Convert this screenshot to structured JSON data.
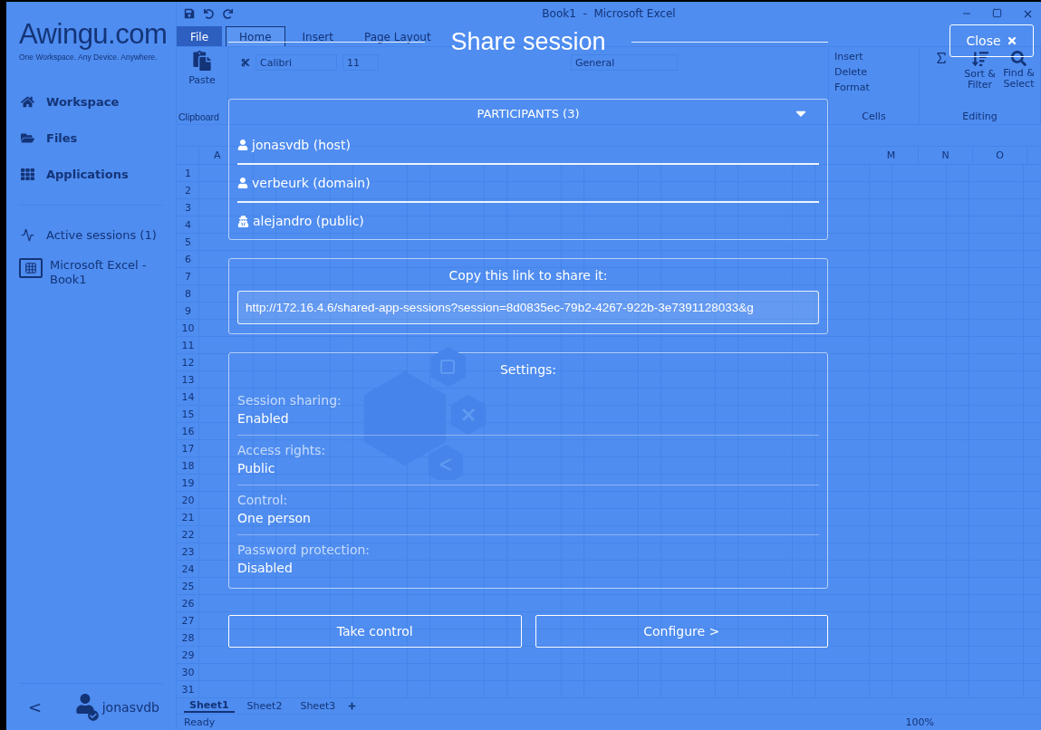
{
  "sidebar": {
    "logo": "Awingu.com",
    "tagline": "One Workspace. Any Device. Anywhere.",
    "nav": [
      {
        "kind": "home",
        "label": "Workspace"
      },
      {
        "kind": "files",
        "label": "Files"
      },
      {
        "kind": "apps",
        "label": "Applications"
      }
    ],
    "sessions_header": "Active sessions (1)",
    "sessions": [
      {
        "label": "Microsoft Excel - Book1"
      }
    ],
    "back": "<",
    "user": "jonasvdb"
  },
  "excel": {
    "title": "Book1  -  Microsoft Excel",
    "tabs": [
      {
        "kind": "file",
        "label": "File",
        "selected": false
      },
      {
        "kind": "tab",
        "label": "Home",
        "selected": true
      },
      {
        "kind": "tab",
        "label": "Insert",
        "selected": false
      },
      {
        "kind": "tab",
        "label": "Page Layout",
        "selected": false
      }
    ],
    "ribbon": {
      "paste": "Paste",
      "clipboard": "Clipboard",
      "font": "Calibri",
      "size": "11",
      "number_format": "General",
      "cell_actions": [
        "Insert",
        "Delete",
        "Format"
      ],
      "cells": "Cells",
      "sort": "Sort & Filter",
      "find": "Find & Select",
      "editing": "Editing"
    },
    "columns_left": [
      "A"
    ],
    "columns_right": [
      "M",
      "N",
      "O"
    ],
    "rows": [
      "1",
      "2",
      "3",
      "4",
      "5",
      "6",
      "7",
      "8",
      "9",
      "10",
      "11",
      "12",
      "13",
      "14",
      "15",
      "16",
      "17",
      "18",
      "19",
      "20",
      "21",
      "22",
      "23",
      "24",
      "25",
      "26",
      "27",
      "28",
      "29",
      "30",
      "31"
    ],
    "sheets": [
      {
        "label": "Sheet1",
        "selected": true
      },
      {
        "label": "Sheet2",
        "selected": false
      },
      {
        "label": "Sheet3",
        "selected": false
      }
    ],
    "status": "Ready",
    "zoom": "100%"
  },
  "dialog": {
    "title": "Share session",
    "close": "Close",
    "participants": {
      "header": "PARTICIPANTS (3)",
      "expanded": true,
      "items": [
        {
          "kind": "user",
          "label": "jonasvdb (host)"
        },
        {
          "kind": "user",
          "label": "verbeurk (domain)"
        },
        {
          "kind": "public",
          "label": "alejandro (public)"
        }
      ]
    },
    "link": {
      "label": "Copy this link to share it:",
      "value": "http://172.16.4.6/shared-app-sessions?session=8d0835ec-79b2-4267-922b-3e7391128033&g"
    },
    "settings": {
      "title": "Settings:",
      "items": [
        {
          "label": "Session sharing:",
          "value": "Enabled"
        },
        {
          "label": "Access rights:",
          "value": "Public"
        },
        {
          "label": "Control:",
          "value": "One person"
        },
        {
          "label": "Password protection:",
          "value": "Disabled"
        }
      ]
    },
    "buttons": [
      "Take control",
      "Configure >"
    ]
  }
}
